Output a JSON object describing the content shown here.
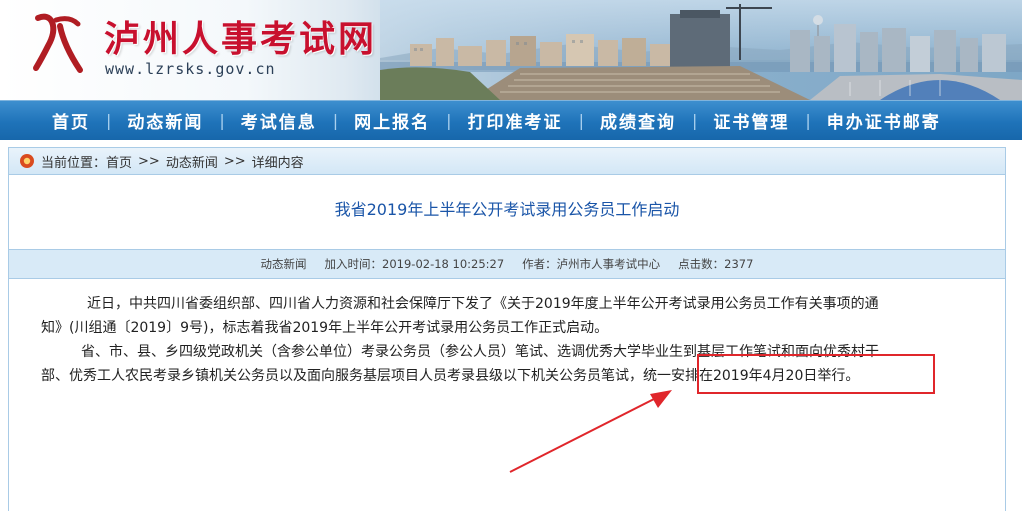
{
  "header": {
    "site_title": "泸州人事考试网",
    "site_url": "www.lzrsks.gov.cn",
    "logo_icon": "lz-logo-icon"
  },
  "nav": {
    "items": [
      {
        "label": "首页"
      },
      {
        "label": "动态新闻"
      },
      {
        "label": "考试信息"
      },
      {
        "label": "网上报名"
      },
      {
        "label": "打印准考证"
      },
      {
        "label": "成绩查询"
      },
      {
        "label": "证书管理"
      },
      {
        "label": "申办证书邮寄"
      }
    ]
  },
  "breadcrumb": {
    "prefix": "当前位置：",
    "items": [
      "首页",
      "动态新闻",
      "详细内容"
    ],
    "separator": ">>"
  },
  "article": {
    "title": "我省2019年上半年公开考试录用公务员工作启动",
    "meta": {
      "category": "动态新闻",
      "added_time": "加入时间：2019-02-18 10:25:27",
      "author": "作者：泸州市人事考试中心",
      "clicks": "点击数：2377"
    },
    "paragraphs": [
      "近日，中共四川省委组织部、四川省人力资源和社会保障厅下发了《关于2019年度上半年公开考试录用公务员工作有关事项的通",
      "知》(川组通〔2019〕9号)，标志着我省2019年上半年公开考试录用公务员工作正式启动。",
      "省、市、县、乡四级党政机关（含参公单位）考录公务员（参公人员）笔试、选调优秀大学毕业生到基层工作笔试和面向优秀村干",
      "部、优秀工人农民考录乡镇机关公务员以及面向服务基层项目人员考录县级以下机关公务员笔试，统一安排在2019年4月20日举行。"
    ]
  },
  "colors": {
    "nav_bg": "#1f73b9",
    "title_red": "#c8102e",
    "link_blue": "#1a55a8",
    "annotation_red": "#e0262b"
  }
}
